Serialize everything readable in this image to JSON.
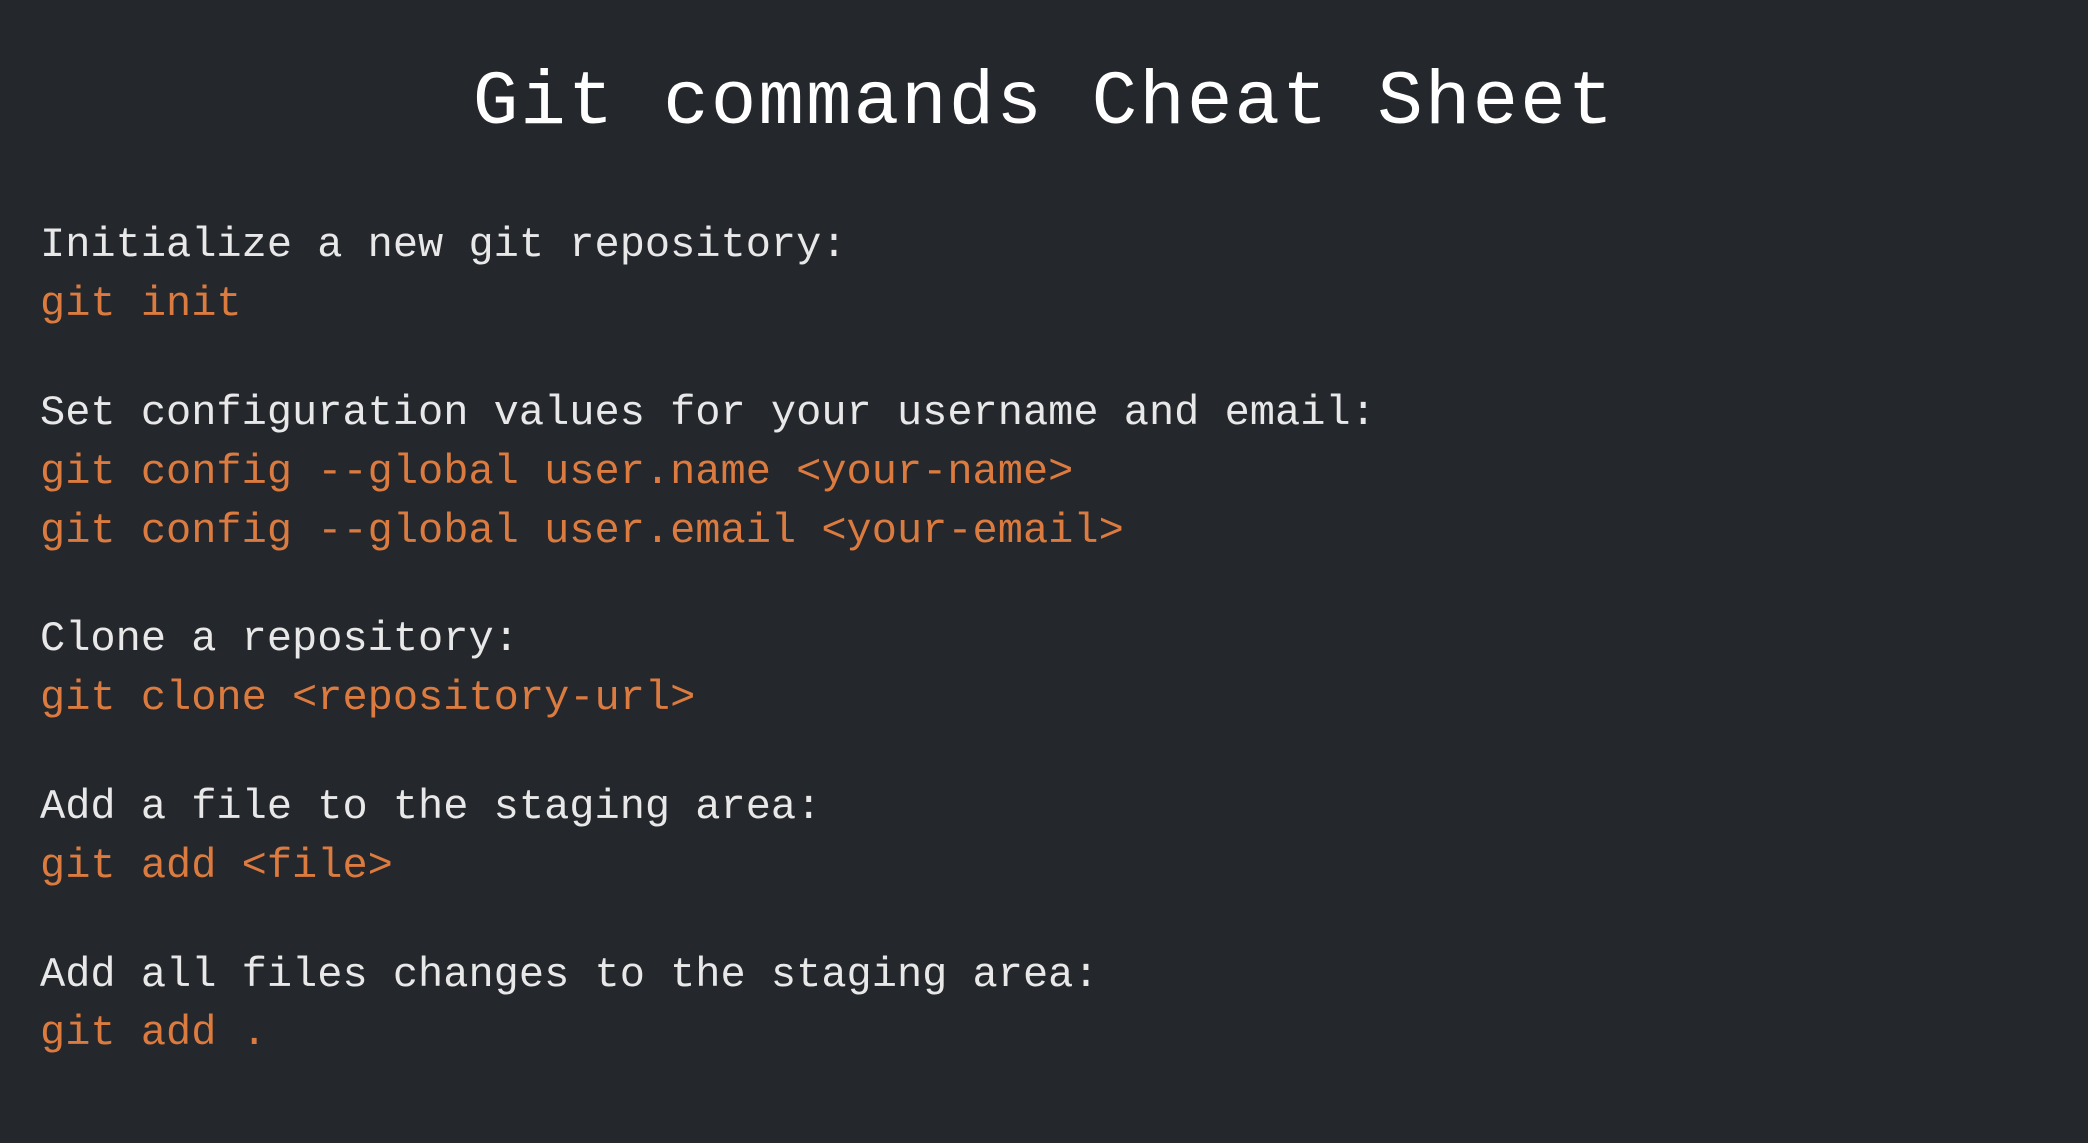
{
  "title": "Git commands Cheat Sheet",
  "entries": [
    {
      "description": "Initialize a new git repository:",
      "commands": [
        "git init"
      ]
    },
    {
      "description": "Set configuration values for your username and email:",
      "commands": [
        "git config --global user.name <your-name>",
        "git config --global user.email <your-email>"
      ]
    },
    {
      "description": "Clone a repository:",
      "commands": [
        "git clone <repository-url>"
      ]
    },
    {
      "description": "Add a file to the staging area:",
      "commands": [
        "git add <file>"
      ]
    },
    {
      "description": "Add all files changes to the staging area:",
      "commands": [
        "git add ."
      ]
    }
  ]
}
